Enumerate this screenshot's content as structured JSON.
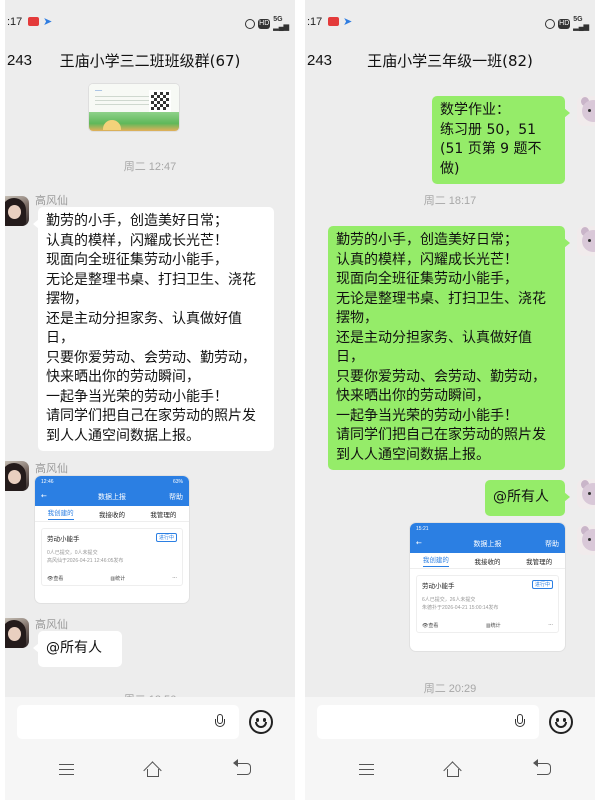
{
  "left": {
    "status_time": ":17",
    "back_badge": "243",
    "title": "王庙小学三二班班级群(67)",
    "time_1": "周二 12:47",
    "sender_1": "高风仙",
    "message_1": "勤劳的小手，创造美好日常；\n认真的模样，闪耀成长光芒！\n现面向全班征集劳动小能手，\n无论是整理书桌、打扫卫生、浇花摆物，\n还是主动分担家务、认真做好值日，\n只要你爱劳动、会劳动、勤劳动，快来晒出你的劳动瞬间，\n一起争当光荣的劳动小能手！\n请同学们把自己在家劳动的照片发到人人通空间数据上报。",
    "sender_2": "高风仙",
    "card": {
      "status_time": "12:46",
      "status_right": "63%",
      "title": "数据上报",
      "help": "帮助",
      "tabs": [
        "我创建的",
        "我接收的",
        "我管理的"
      ],
      "item_title": "劳动小能手",
      "item_badge": "进行中",
      "item_count": "0人已提交，0人未提交",
      "item_time": "高风仙于2026-04-21 12:46:05发布",
      "action_view": "查看",
      "action_stats": "统计",
      "action_more": "···"
    },
    "sender_3": "高风仙",
    "message_3": "@所有人",
    "time_2": "周二 12:56"
  },
  "right": {
    "status_time": ":17",
    "back_badge": "243",
    "title": "王庙小学三年级一班(82)",
    "message_1": "数学作业：\n练习册 50，51\n(51 页第 9 题不做)",
    "time_1": "周二 18:17",
    "message_2": "勤劳的小手，创造美好日常；\n认真的模样，闪耀成长光芒！\n现面向全班征集劳动小能手，\n无论是整理书桌、打扫卫生、浇花摆物，\n还是主动分担家务、认真做好值日，\n只要你爱劳动、会劳动、勤劳动，快来晒出你的劳动瞬间，\n一起争当光荣的劳动小能手！\n请同学们把自己在家劳动的照片发到人人通空间数据上报。",
    "message_3": "@所有人",
    "card": {
      "status_time": "15:21",
      "status_right": "",
      "title": "数据上报",
      "help": "帮助",
      "tabs": [
        "我创建的",
        "我接收的",
        "我管理的"
      ],
      "item_title": "劳动小能手",
      "item_badge": "进行中",
      "item_count": "6人已提交，26人未提交",
      "item_time": "朱德扑于2026-04-21 15:00:14发布",
      "action_view": "查看",
      "action_stats": "统计",
      "action_more": "···"
    },
    "time_2": "周二 20:29"
  },
  "icons": {
    "status": [
      "alarm-icon",
      "hd-icon",
      "5g-signal-icon"
    ],
    "input": [
      "microphone-icon",
      "emoji-icon"
    ],
    "nav": [
      "menu-icon",
      "home-icon",
      "back-icon"
    ]
  },
  "colors": {
    "chat_background": "#ededed",
    "sent_bubble": "#95ec69",
    "received_bubble": "#ffffff",
    "card_header": "#2b7fe3"
  }
}
